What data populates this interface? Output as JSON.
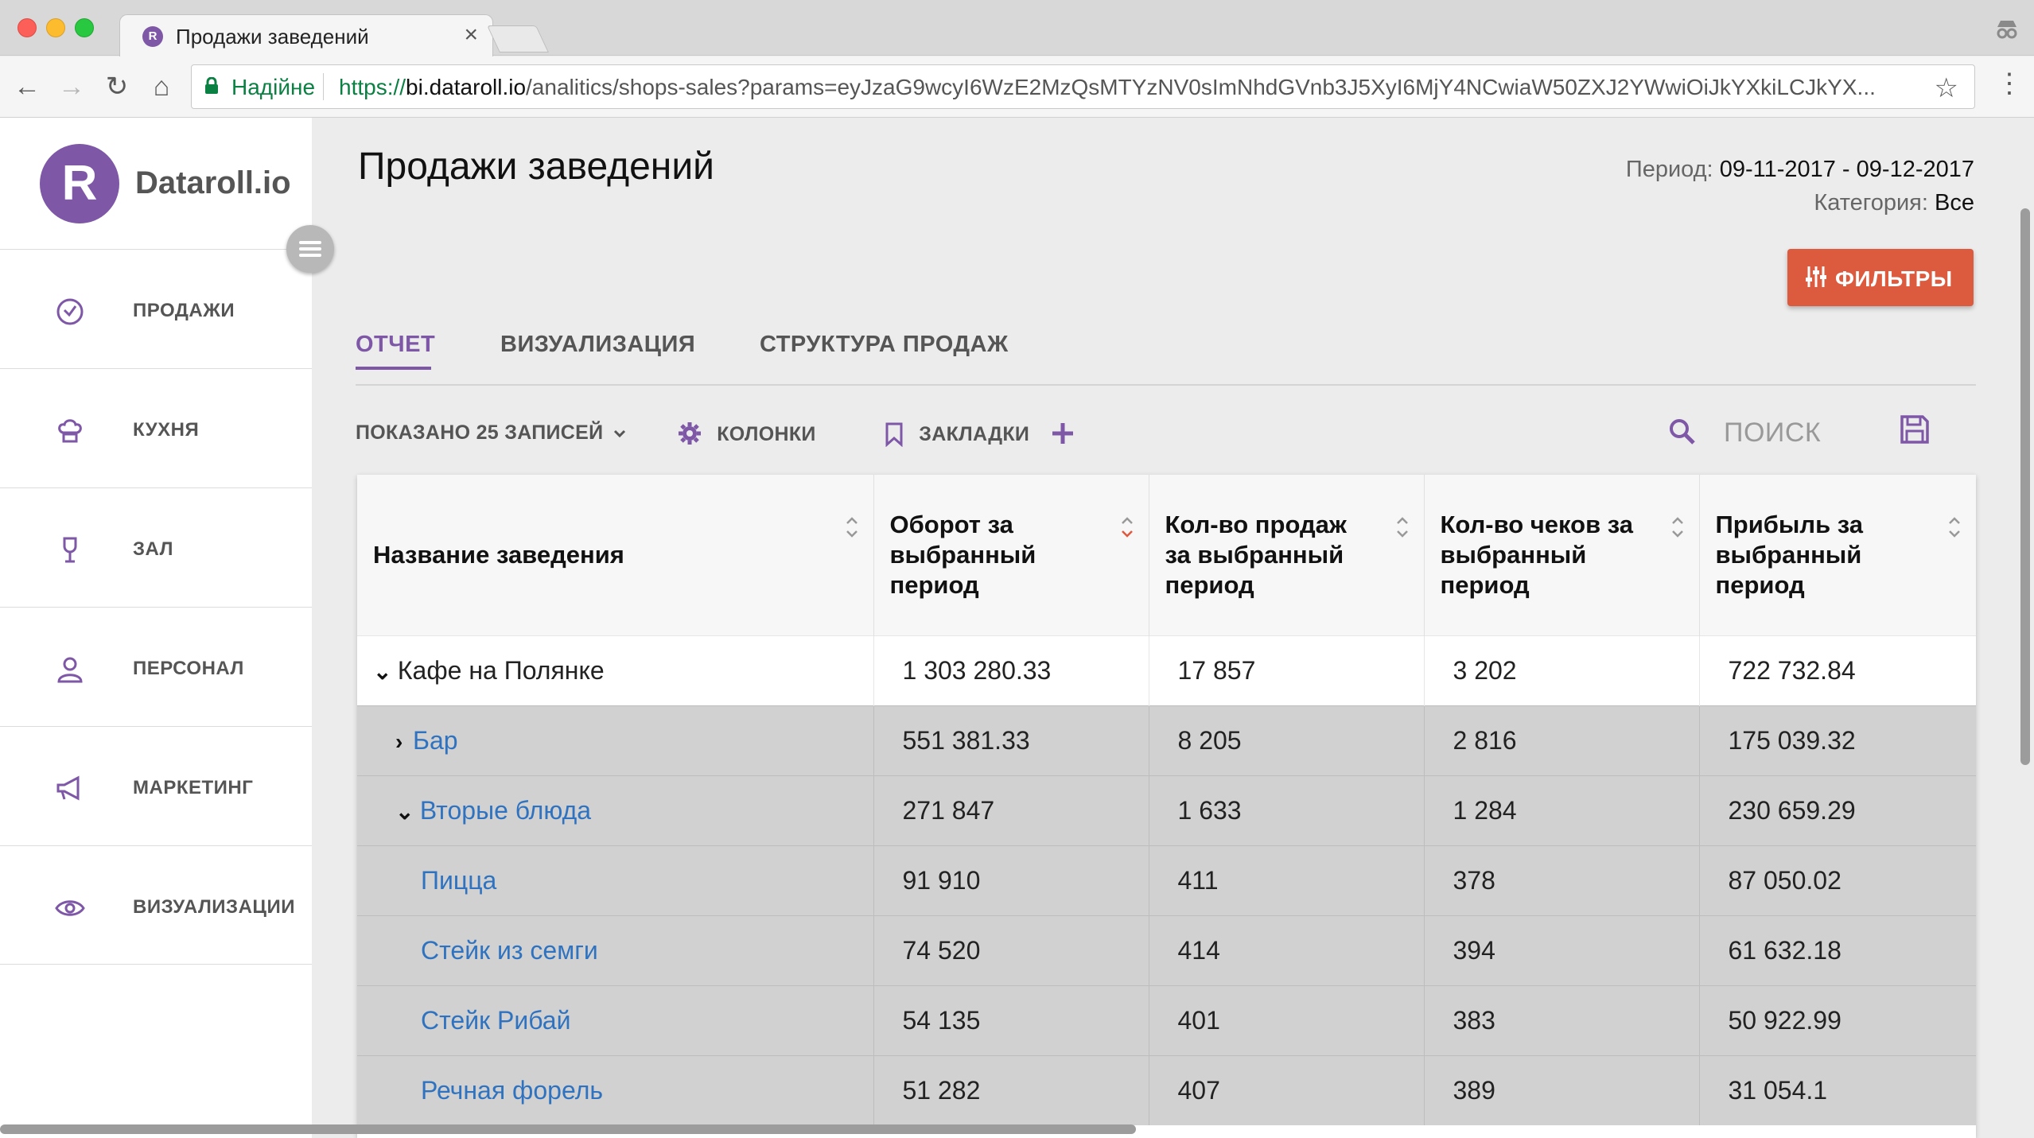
{
  "browser": {
    "tab_title": "Продажи заведений",
    "tab_favicon_letter": "R",
    "close_glyph": "×",
    "secure_label": "Надійне",
    "url_scheme": "https://",
    "url_host": "bi.dataroll.io",
    "url_path": "/analitics/shops-sales?params=eyJzaG9wcyI6WzE2MzQsMTYzNV0sImNhdGVnb3J5XyI6MjY4NCwiaW50ZXJ2YWwiOiJkYXkiLCJkYX..."
  },
  "sidebar": {
    "logo_letter": "R",
    "logo_text": "Dataroll.io",
    "items": [
      {
        "label": "ПРОДАЖИ",
        "icon": "clock-icon"
      },
      {
        "label": "КУХНЯ",
        "icon": "chef-hat-icon"
      },
      {
        "label": "ЗАЛ",
        "icon": "wine-glass-icon"
      },
      {
        "label": "ПЕРСОНАЛ",
        "icon": "person-icon"
      },
      {
        "label": "МАРКЕТИНГ",
        "icon": "megaphone-icon"
      },
      {
        "label": "ВИЗУАЛИЗАЦИИ",
        "icon": "eye-icon"
      }
    ]
  },
  "header": {
    "title": "Продажи заведений",
    "period_label": "Период:",
    "period_value": "09-11-2017 - 09-12-2017",
    "category_label": "Категория:",
    "category_value": "Все",
    "filters_label": "ФИЛЬТРЫ"
  },
  "tabs": [
    {
      "label": "ОТЧЕТ",
      "active": true
    },
    {
      "label": "ВИЗУАЛИЗАЦИЯ",
      "active": false
    },
    {
      "label": "СТРУКТУРА ПРОДАЖ",
      "active": false
    }
  ],
  "controls": {
    "shown_label": "ПОКАЗАНО 25 ЗАПИСЕЙ",
    "columns_label": "КОЛОНКИ",
    "bookmarks_label": "ЗАКЛАДКИ",
    "search_placeholder": "ПОИСК"
  },
  "table": {
    "columns": [
      "Название заведения",
      "Оборот за выбранный период",
      "Кол-во продаж за выбранный период",
      "Кол-во чеков за выбранный период",
      "Прибыль за выбранный период"
    ],
    "rows": [
      {
        "level": 0,
        "caret": "down",
        "name": "Кафе на Полянке",
        "turnover": "1 303 280.33",
        "sales": "17 857",
        "checks": "3 202",
        "profit": "722 732.84"
      },
      {
        "level": 1,
        "caret": "right",
        "name": "Бар",
        "turnover": "551 381.33",
        "sales": "8 205",
        "checks": "2 816",
        "profit": "175 039.32"
      },
      {
        "level": 1,
        "caret": "down",
        "name": "Вторые блюда",
        "turnover": "271 847",
        "sales": "1 633",
        "checks": "1 284",
        "profit": "230 659.29"
      },
      {
        "level": 2,
        "caret": "",
        "name": "Пицца",
        "turnover": "91 910",
        "sales": "411",
        "checks": "378",
        "profit": "87 050.02"
      },
      {
        "level": 2,
        "caret": "",
        "name": "Стейк из семги",
        "turnover": "74 520",
        "sales": "414",
        "checks": "394",
        "profit": "61 632.18"
      },
      {
        "level": 2,
        "caret": "",
        "name": "Стейк Рибай",
        "turnover": "54 135",
        "sales": "401",
        "checks": "383",
        "profit": "50 922.99"
      },
      {
        "level": 2,
        "caret": "",
        "name": "Речная форель",
        "turnover": "51 282",
        "sales": "407",
        "checks": "389",
        "profit": "31 054.1"
      }
    ]
  },
  "colors": {
    "accent": "#7e57a7",
    "filters_button": "#dc5a3e",
    "link": "#2f73c0",
    "secure_green": "#0b8043"
  }
}
